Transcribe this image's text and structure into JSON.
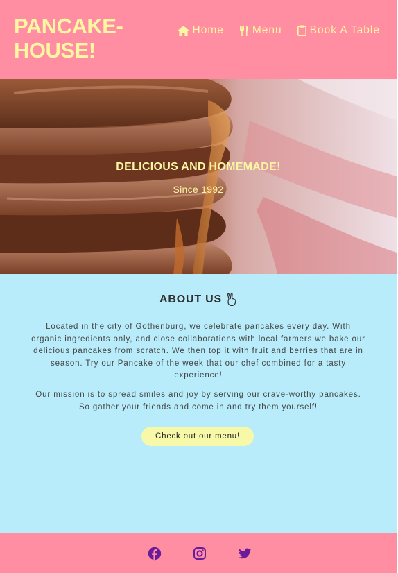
{
  "header": {
    "logo": "PANCAKE-HOUSE!",
    "nav": [
      {
        "label": "Home",
        "icon": "home-icon"
      },
      {
        "label": "Menu",
        "icon": "utensils-icon"
      },
      {
        "label": "Book A Table",
        "icon": "clipboard-icon"
      }
    ]
  },
  "hero": {
    "title": "DELICIOUS AND HOMEMADE!",
    "subtitle": "Since 1992"
  },
  "about": {
    "title": "ABOUT US",
    "title_icon": "peace-hand-icon",
    "paragraph1": "Located in the city of Gothenburg, we celebrate pancakes every day. With organic ingredients only, and close collaborations with local farmers we bake our delicious pancakes from scratch. We then top it with fruit and berries that are in season. Try our Pancake of the week that our chef combined for a tasty experience!",
    "paragraph2": "Our mission is to spread smiles and joy by serving our crave-worthy pancakes. So gather your friends and come in and try them yourself!",
    "button_label": "Check out our menu!"
  },
  "footer": {
    "social": [
      "facebook-icon",
      "instagram-icon",
      "twitter-icon"
    ]
  },
  "colors": {
    "header_bg": "#ff8ea3",
    "accent_yellow": "#fdf6a3",
    "about_bg": "#b8ecfa",
    "button_bg": "#f8f9a8",
    "social_icon": "#6a1b9a"
  }
}
